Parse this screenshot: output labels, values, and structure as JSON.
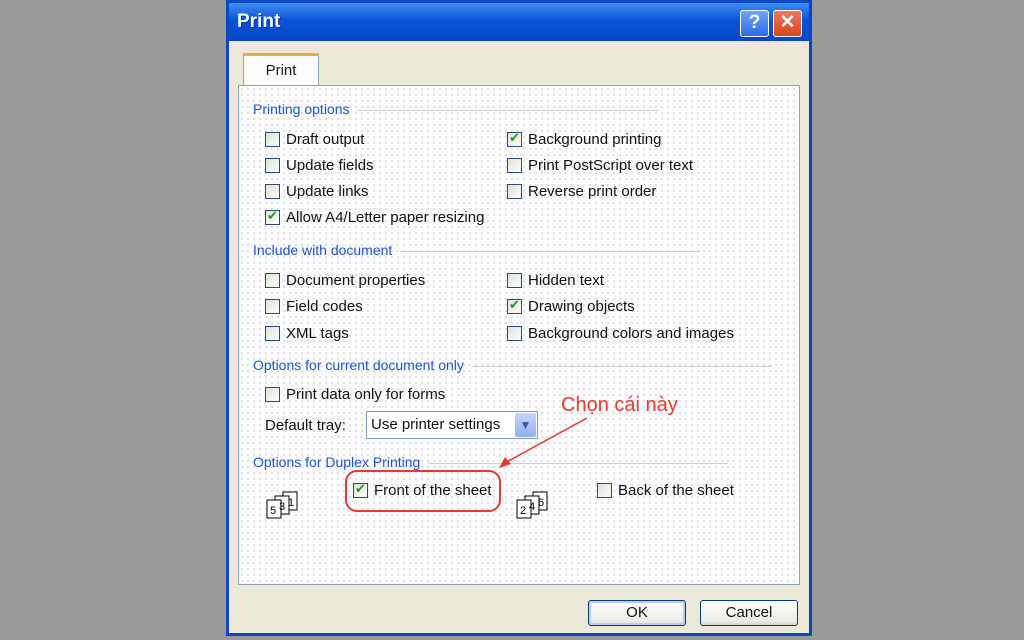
{
  "window": {
    "title": "Print",
    "help_glyph": "?",
    "close_glyph": "✕"
  },
  "tabs": [
    {
      "label": "Print"
    }
  ],
  "printing_options": {
    "heading": "Printing options",
    "left": [
      {
        "label": "Draft output",
        "checked": false
      },
      {
        "label": "Update fields",
        "checked": false
      },
      {
        "label": "Update links",
        "checked": false
      },
      {
        "label": "Allow A4/Letter paper resizing",
        "checked": true
      }
    ],
    "right": [
      {
        "label": "Background printing",
        "checked": true
      },
      {
        "label": "Print PostScript over text",
        "checked": false
      },
      {
        "label": "Reverse print order",
        "checked": false
      }
    ]
  },
  "include_with_document": {
    "heading": "Include with document",
    "left": [
      {
        "label": "Document properties",
        "checked": false
      },
      {
        "label": "Field codes",
        "checked": false
      },
      {
        "label": "XML tags",
        "checked": false
      }
    ],
    "right": [
      {
        "label": "Hidden text",
        "checked": false
      },
      {
        "label": "Drawing objects",
        "checked": true
      },
      {
        "label": "Background colors and images",
        "checked": false
      }
    ]
  },
  "current_document_options": {
    "heading": "Options for current document only",
    "print_data_only": {
      "label": "Print data only for forms",
      "checked": false
    },
    "default_tray_label": "Default tray:",
    "default_tray_value": "Use printer settings"
  },
  "duplex": {
    "heading": "Options for Duplex Printing",
    "front": {
      "label": "Front of the sheet",
      "checked": true
    },
    "back": {
      "label": "Back of the sheet",
      "checked": false
    },
    "front_icon_pages": [
      "5",
      "3",
      "1"
    ],
    "back_icon_pages": [
      "2",
      "4",
      "6"
    ]
  },
  "annotation": {
    "text": "Chọn cái này",
    "color": "#e43a2f"
  },
  "buttons": {
    "ok": "OK",
    "cancel": "Cancel"
  }
}
